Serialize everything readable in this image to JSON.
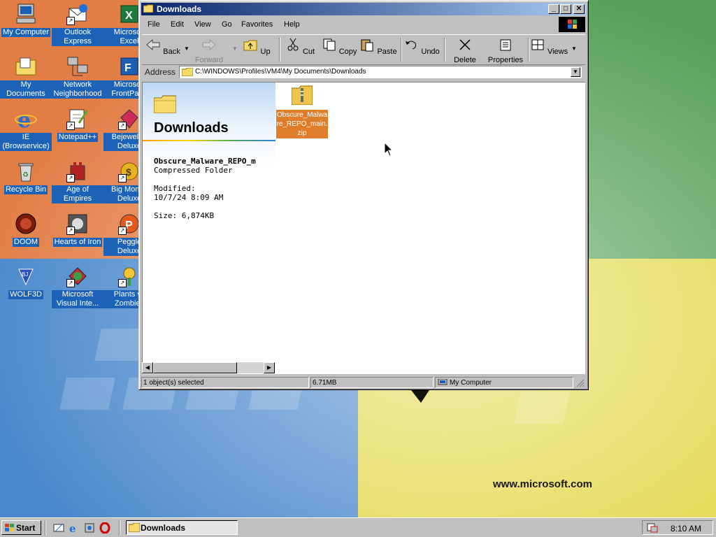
{
  "desktop": {
    "watermark": "www.microsoft.com",
    "icons": [
      {
        "label": "My Computer"
      },
      {
        "label": "Outlook Express"
      },
      {
        "label": "Microsoft Excel"
      },
      {
        "label": "My Documents"
      },
      {
        "label": "Network Neighborhood"
      },
      {
        "label": "Microsoft FrontPage"
      },
      {
        "label": "IE (Browservice)"
      },
      {
        "label": "Notepad++"
      },
      {
        "label": "Bejeweled Deluxe"
      },
      {
        "label": "Recycle Bin"
      },
      {
        "label": "Age of Empires"
      },
      {
        "label": "Big Money Deluxe"
      },
      {
        "label": "DOOM"
      },
      {
        "label": "Hearts of Iron"
      },
      {
        "label": "Peggle Deluxe"
      },
      {
        "label": "WOLF3D"
      },
      {
        "label": "Microsoft Visual Inte..."
      },
      {
        "label": "Plants vs Zombies"
      }
    ]
  },
  "window": {
    "title": "Downloads",
    "menu": [
      "File",
      "Edit",
      "View",
      "Go",
      "Favorites",
      "Help"
    ],
    "toolbar": {
      "back": "Back",
      "forward": "Forward",
      "up": "Up",
      "cut": "Cut",
      "copy": "Copy",
      "paste": "Paste",
      "undo": "Undo",
      "delete": "Delete",
      "properties": "Properties",
      "views": "Views"
    },
    "address": {
      "label": "Address",
      "value": "C:\\WINDOWS\\Profiles\\VM4\\My Documents\\Downloads"
    },
    "content": {
      "folder_title": "Downloads",
      "selected_name": "Obscure_Malware_REPO_m",
      "selected_type": "Compressed Folder",
      "modified_label": "Modified:",
      "modified_value": "10/7/24 8:09 AM",
      "size": "Size: 6,874KB",
      "file_label": "Obscure_Malware_REPO_main.zip"
    },
    "status": {
      "selection": "1 object(s) selected",
      "size": "6.71MB",
      "zone": "My Computer"
    }
  },
  "taskbar": {
    "start": "Start",
    "task_downloads": "Downloads",
    "clock": "8:10 AM"
  },
  "colors": {
    "titlebar_start": "#0a246a",
    "titlebar_end": "#a6caf0",
    "selection": "#e07d2a",
    "face": "#c0c0c0"
  }
}
